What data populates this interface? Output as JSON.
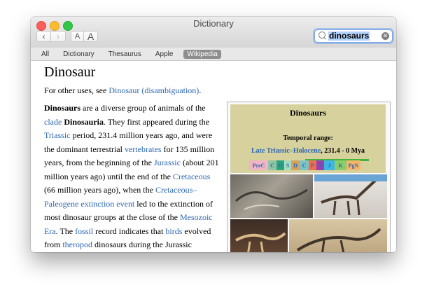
{
  "window": {
    "title": "Dictionary"
  },
  "toolbar": {
    "font_smaller": "A",
    "font_larger": "A",
    "back_glyph": "‹",
    "forward_glyph": "›"
  },
  "search": {
    "value": "dinosaurs"
  },
  "tabs": [
    {
      "label": "All"
    },
    {
      "label": "Dictionary"
    },
    {
      "label": "Thesaurus"
    },
    {
      "label": "Apple"
    },
    {
      "label": "Wikipedia"
    }
  ],
  "article": {
    "title": "Dinosaur",
    "hatnote_prefix": "For other uses, see ",
    "hatnote_link": "Dinosaur (disambiguation)",
    "hatnote_suffix": ".",
    "p": [
      "Dinosaurs",
      " are a diverse group of animals of the ",
      "clade",
      " ",
      "Dinosauria",
      ". They first appeared during the ",
      "Triassic",
      " period, 231.4 million years ago, and were the dominant terrestrial ",
      "vertebrates",
      " for 135 million years, from the beginning of the ",
      "Jurassic",
      " (about 201 million years ago) until the end of the ",
      "Cretaceous",
      " (66 million years ago), when the ",
      "Cretaceous–Paleogene extinction event",
      " led to the extinction of most dinosaur groups at the close of the ",
      "Mesozoic Era",
      ". The ",
      "fossil",
      " record indicates that ",
      "birds",
      " evolved from ",
      "theropod",
      " dinosaurs during the Jurassic"
    ]
  },
  "infobox": {
    "title": "Dinosaurs",
    "temporal_range_label": "Temporal range:",
    "range_link": "Late Triassic–Holocene",
    "range_value": ", 231.4 - 0 Mya",
    "periods": [
      "PreC",
      "C",
      "O",
      "S",
      "D",
      "C",
      "P",
      "T",
      "J",
      "K",
      "PgN"
    ]
  },
  "colors": {
    "link": "#2d67b2",
    "infobox_header": "#d7d29d",
    "selected_tab": "#8e8e8e"
  }
}
